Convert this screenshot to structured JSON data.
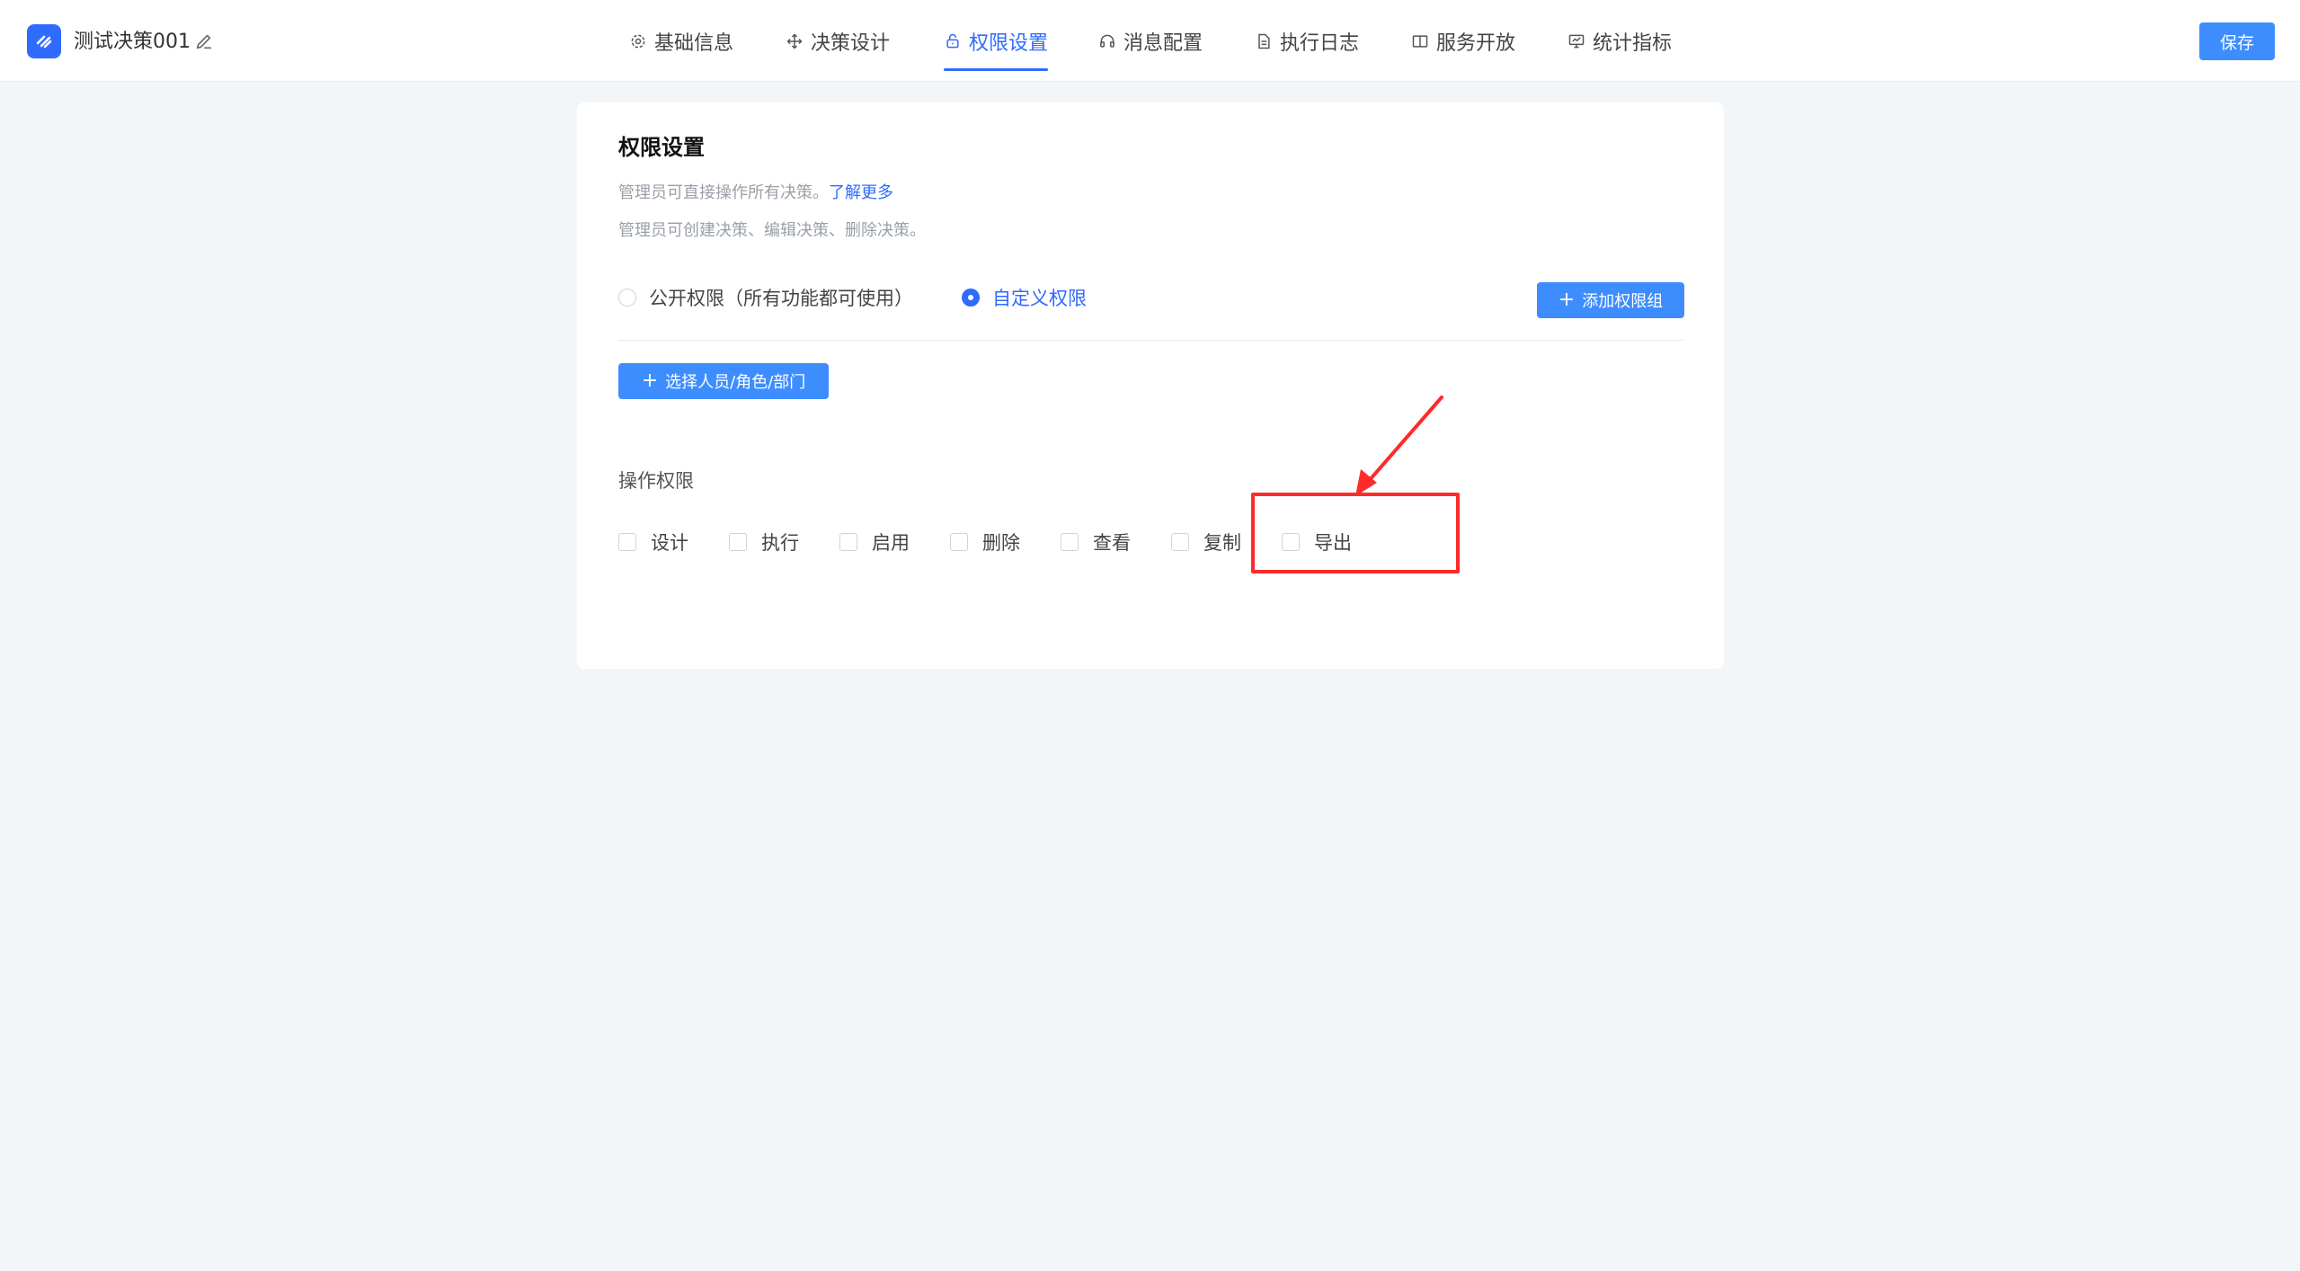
{
  "header": {
    "title": "测试决策001",
    "save_label": "保存",
    "nav": [
      {
        "label": "基础信息",
        "icon": "gear-icon"
      },
      {
        "label": "决策设计",
        "icon": "move-icon"
      },
      {
        "label": "权限设置",
        "icon": "lock-icon",
        "active": true
      },
      {
        "label": "消息配置",
        "icon": "headset-icon"
      },
      {
        "label": "执行日志",
        "icon": "document-icon"
      },
      {
        "label": "服务开放",
        "icon": "book-icon"
      },
      {
        "label": "统计指标",
        "icon": "chart-icon"
      }
    ]
  },
  "card": {
    "title": "权限设置",
    "desc1": "管理员可直接操作所有决策。",
    "learn_more": "了解更多",
    "desc2": "管理员可创建决策、编辑决策、删除决策。",
    "radios": [
      {
        "label": "公开权限（所有功能都可使用）",
        "checked": false
      },
      {
        "label": "自定义权限",
        "checked": true
      }
    ],
    "add_group_label": "添加权限组",
    "select_people_label": "选择人员/角色/部门",
    "operations_label": "操作权限",
    "operations": [
      "设计",
      "执行",
      "启用",
      "删除",
      "查看",
      "复制",
      "导出"
    ]
  },
  "colors": {
    "primary": "#2f6bff",
    "button": "#3d8dff",
    "annotation": "#ff2a2a",
    "background": "#f3f6f9"
  }
}
